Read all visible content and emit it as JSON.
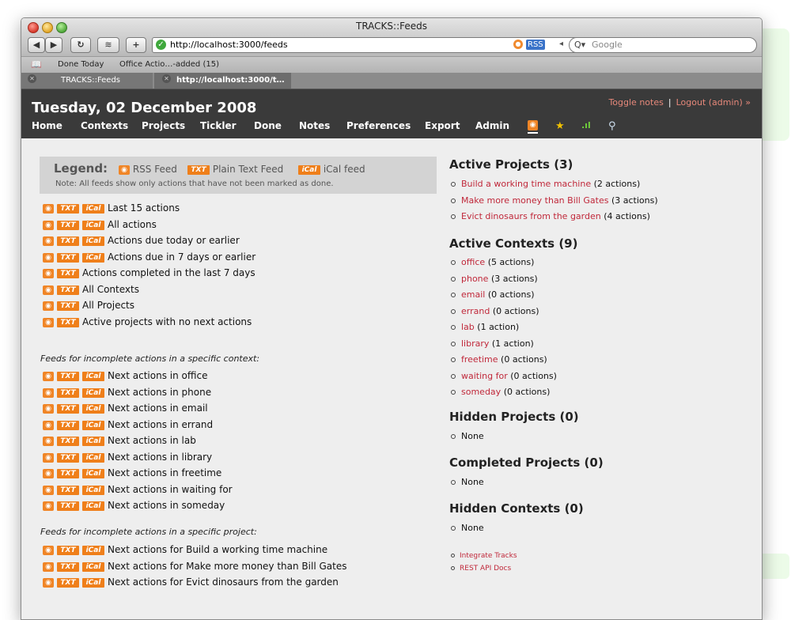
{
  "browser": {
    "window_title": "TRACKS::Feeds",
    "url": "http://localhost:3000/feeds",
    "rss_badge": "RSS",
    "search_placeholder": "Google",
    "bookmarks": [
      "Done Today",
      "Office Actio…-added (15)"
    ],
    "tabs": [
      "TRACKS::Feeds",
      "http://localhost:3000/t…"
    ]
  },
  "header": {
    "date": "Tuesday, 02 December 2008",
    "toggle_notes": "Toggle notes",
    "logout": "Logout (admin) »",
    "nav": [
      "Home",
      "Contexts",
      "Projects",
      "Tickler",
      "Done",
      "Notes",
      "Preferences",
      "Export",
      "Admin"
    ]
  },
  "legend": {
    "title": "Legend:",
    "rss": "RSS Feed",
    "txt": "Plain Text Feed",
    "ical": "iCal feed",
    "note": "Note: All feeds show only actions that have not been marked as done.",
    "txt_badge": "TXT",
    "ical_badge": "iCal"
  },
  "feeds_general": [
    {
      "label": "Last 15 actions",
      "ical": true
    },
    {
      "label": "All actions",
      "ical": true
    },
    {
      "label": "Actions due today or earlier",
      "ical": true
    },
    {
      "label": "Actions due in 7 days or earlier",
      "ical": true
    },
    {
      "label": "Actions completed in the last 7 days",
      "ical": false
    },
    {
      "label": "All Contexts",
      "ical": false
    },
    {
      "label": "All Projects",
      "ical": false
    },
    {
      "label": "Active projects with no next actions",
      "ical": false
    }
  ],
  "context_heading": "Feeds for incomplete actions in a specific context:",
  "feeds_context": [
    "Next actions in office",
    "Next actions in phone",
    "Next actions in email",
    "Next actions in errand",
    "Next actions in lab",
    "Next actions in library",
    "Next actions in freetime",
    "Next actions in waiting for",
    "Next actions in someday"
  ],
  "project_heading": "Feeds for incomplete actions in a specific project:",
  "feeds_project": [
    "Next actions for Build a working time machine",
    "Next actions for Make more money than Bill Gates",
    "Next actions for Evict dinosaurs from the garden"
  ],
  "active_projects": {
    "title": "Active Projects (3)",
    "items": [
      {
        "name": "Build a working time machine",
        "count": "(2 actions)"
      },
      {
        "name": "Make more money than Bill Gates",
        "count": "(3 actions)"
      },
      {
        "name": "Evict dinosaurs from the garden",
        "count": "(4 actions)"
      }
    ]
  },
  "active_contexts": {
    "title": "Active Contexts (9)",
    "items": [
      {
        "name": "office",
        "count": "(5 actions)"
      },
      {
        "name": "phone",
        "count": "(3 actions)"
      },
      {
        "name": "email",
        "count": "(0 actions)"
      },
      {
        "name": "errand",
        "count": "(0 actions)"
      },
      {
        "name": "lab",
        "count": "(1 action)"
      },
      {
        "name": "library",
        "count": "(1 action)"
      },
      {
        "name": "freetime",
        "count": "(0 actions)"
      },
      {
        "name": "waiting for",
        "count": "(0 actions)"
      },
      {
        "name": "someday",
        "count": "(0 actions)"
      }
    ]
  },
  "hidden_projects": {
    "title": "Hidden Projects (0)",
    "items": [
      "None"
    ]
  },
  "completed_projects": {
    "title": "Completed Projects (0)",
    "items": [
      "None"
    ]
  },
  "hidden_contexts": {
    "title": "Hidden Contexts (0)",
    "items": [
      "None"
    ]
  },
  "footer_links": [
    "Integrate Tracks",
    "REST API Docs"
  ],
  "colors": {
    "link": "#c0283a",
    "header_bg": "#3a3a3a",
    "feed_orange": "#ef7f1a"
  }
}
